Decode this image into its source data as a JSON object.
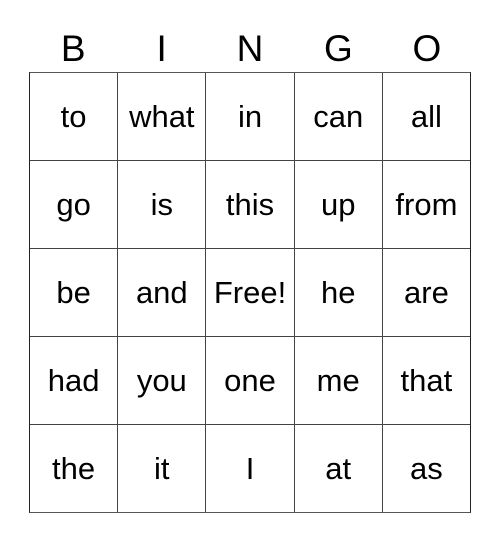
{
  "card": {
    "title": "BINGO",
    "columns": [
      "B",
      "I",
      "N",
      "G",
      "O"
    ],
    "free_space_label": "Free!",
    "rows": [
      {
        "cells": [
          "to",
          "what",
          "in",
          "can",
          "all"
        ]
      },
      {
        "cells": [
          "go",
          "is",
          "this",
          "up",
          "from"
        ]
      },
      {
        "cells": [
          "be",
          "and",
          "Free!",
          "he",
          "are"
        ]
      },
      {
        "cells": [
          "had",
          "you",
          "one",
          "me",
          "that"
        ]
      },
      {
        "cells": [
          "the",
          "it",
          "I",
          "at",
          "as"
        ]
      }
    ],
    "colors": {
      "background": "#ffffff",
      "text": "#000000",
      "grid_line": "#444444",
      "grid_border": "#222222"
    }
  }
}
